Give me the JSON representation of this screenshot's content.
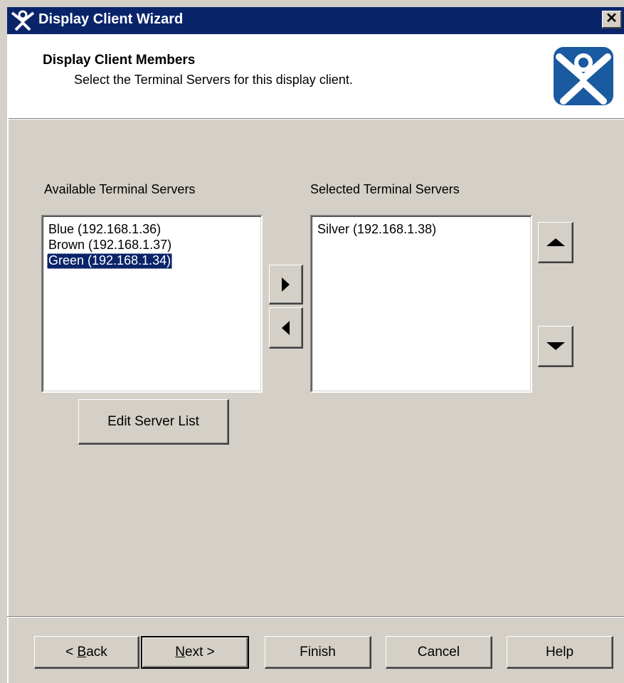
{
  "window": {
    "title": "Display Client Wizard",
    "close_label": "✕"
  },
  "header": {
    "title": "Display Client Members",
    "subtitle": "Select the Terminal Servers for this display client."
  },
  "available": {
    "label": "Available Terminal Servers",
    "items": [
      {
        "label": "Blue (192.168.1.36)",
        "selected": false
      },
      {
        "label": "Brown (192.168.1.37)",
        "selected": false
      },
      {
        "label": "Green (192.168.1.34)",
        "selected": true
      }
    ],
    "edit_button": "Edit Server List"
  },
  "selected": {
    "label": "Selected Terminal Servers",
    "items": [
      {
        "label": "Silver (192.168.1.38)",
        "selected": false
      }
    ]
  },
  "icons": {
    "title": "thinmanager-logo-icon",
    "header": "thinmanager-logo-icon",
    "add": "arrow-right-icon",
    "remove": "arrow-left-icon",
    "move_up": "arrow-up-icon",
    "move_down": "arrow-down-icon"
  },
  "footer": {
    "back_pre": "< ",
    "back_mnemonic": "B",
    "back_post": "ack",
    "next_mnemonic": "N",
    "next_post": "ext >",
    "finish": "Finish",
    "cancel": "Cancel",
    "help": "Help"
  },
  "colors": {
    "titlebar": "#0a246a",
    "selection": "#0a246a",
    "dialog_bg": "#d4d0c8",
    "logo": "#1a5aa0"
  }
}
